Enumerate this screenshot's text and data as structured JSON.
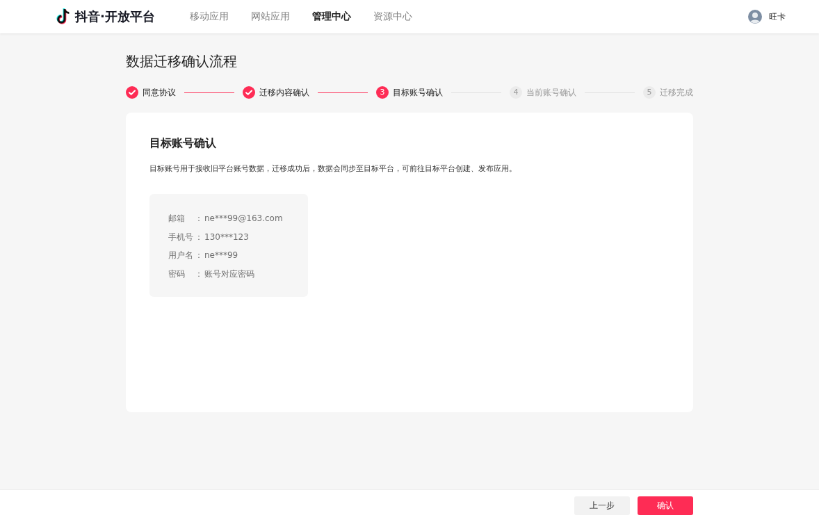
{
  "header": {
    "brand": "抖音·开放平台",
    "nav": [
      {
        "label": "移动应用",
        "selected": false
      },
      {
        "label": "网站应用",
        "selected": false
      },
      {
        "label": "管理中心",
        "selected": true
      },
      {
        "label": "资源中心",
        "selected": false
      }
    ],
    "user": {
      "name": "旺卡"
    }
  },
  "page_title": "数据迁移确认流程",
  "steps": [
    {
      "label": "同意协议",
      "done": true,
      "current": false
    },
    {
      "label": "迁移内容确认",
      "done": true,
      "current": false
    },
    {
      "number": "3",
      "label": "目标账号确认",
      "done": false,
      "current": true
    },
    {
      "number": "4",
      "label": "当前账号确认",
      "done": false,
      "current": false
    },
    {
      "number": "5",
      "label": "迁移完成",
      "done": false,
      "current": false
    }
  ],
  "card": {
    "title": "目标账号确认",
    "description": "目标账号用于接收旧平台账号数据，迁移成功后，数据会同步至目标平台，可前往目标平台创建、发布应用。",
    "fields": [
      {
        "label": "邮箱",
        "sep": "：",
        "value": "ne***99@163.com"
      },
      {
        "label": "手机号",
        "sep": "：",
        "value": "130***123"
      },
      {
        "label": "用户名",
        "sep": "：",
        "value": "ne***99"
      },
      {
        "label": "密码",
        "sep": "：",
        "value": "账号对应密码"
      }
    ]
  },
  "footer": {
    "buttons": [
      {
        "label": "上一步",
        "kind": "secondary"
      },
      {
        "label": "确认",
        "kind": "primary"
      }
    ]
  }
}
